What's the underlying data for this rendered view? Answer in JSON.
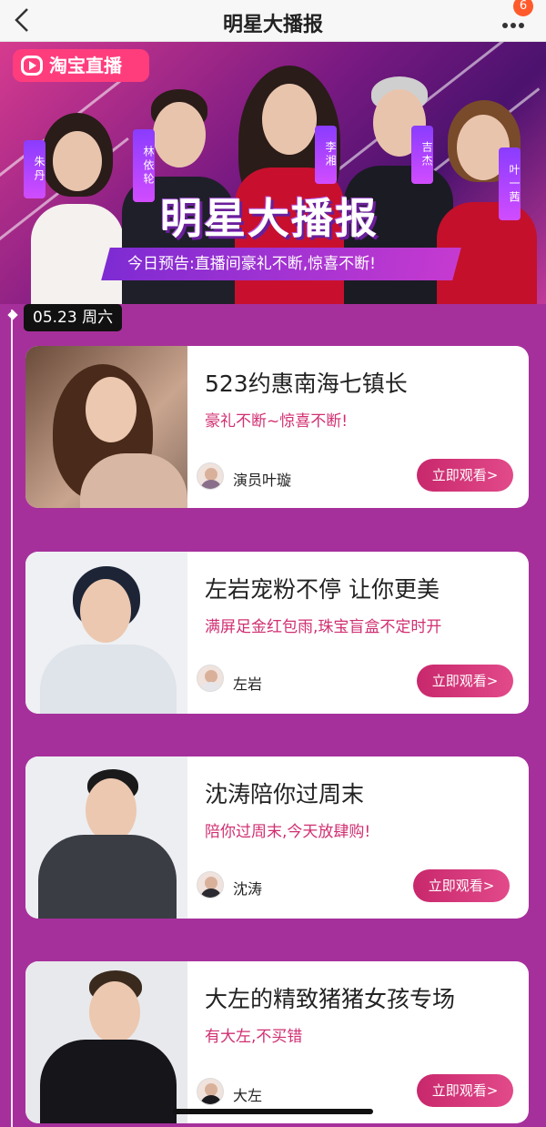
{
  "navbar": {
    "title": "明星大播报",
    "back_icon": "chevron-left-icon",
    "more_icon": "more-dots-icon",
    "badge_count": "6"
  },
  "banner": {
    "logo_text": "淘宝直播",
    "title": "明星大播报",
    "subtitle": "今日预告:直播间豪礼不断,惊喜不断!",
    "names": [
      "朱丹",
      "林依轮",
      "李湘",
      "吉杰",
      "叶一茜"
    ]
  },
  "schedule": {
    "date_label": "05.23 周六",
    "cards": [
      {
        "title": "523约惠南海七镇长",
        "subtitle": "豪礼不断~惊喜不断!",
        "host": "演员叶璇",
        "button": "立即观看>"
      },
      {
        "title": "左岩宠粉不停 让你更美",
        "subtitle": "满屏足金红包雨,珠宝盲盒不定时开",
        "host": "左岩",
        "button": "立即观看>"
      },
      {
        "title": "沈涛陪你过周末",
        "subtitle": "陪你过周末,今天放肆购!",
        "host": "沈涛",
        "button": "立即观看>"
      },
      {
        "title": "大左的精致猪猪女孩专场",
        "subtitle": "有大左,不买错",
        "host": "大左",
        "button": "立即观看>"
      }
    ]
  },
  "colors": {
    "background": "#a6309b",
    "accent": "#d12f72",
    "button": "#c8286c"
  }
}
